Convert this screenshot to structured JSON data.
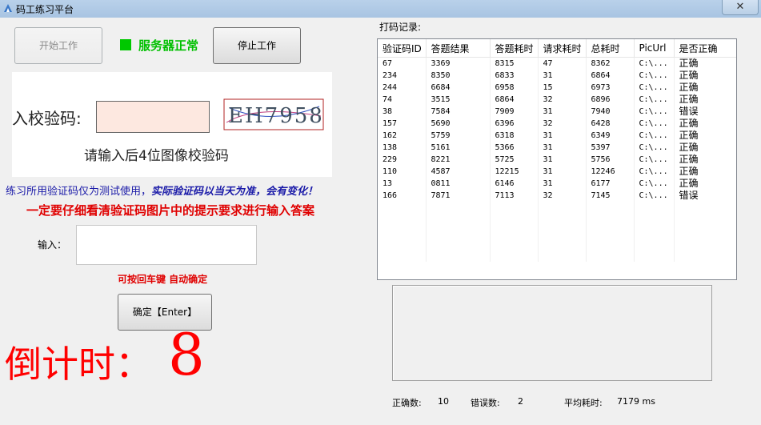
{
  "window": {
    "title": "码工练习平台",
    "close_symbol": "✕"
  },
  "toolbar": {
    "start_label": "开始工作",
    "server_status": "服务器正常",
    "stop_label": "停止工作"
  },
  "captcha": {
    "prompt_label": "入校验码:",
    "image_text": "EH7958",
    "hint": "请输入后4位图像校验码"
  },
  "notes": {
    "line1_plain": "练习所用验证码仅为测试使用，",
    "line1_emph": "实际验证码以当天为准，会有变化！",
    "line2": "一定要仔细看清验证码图片中的提示要求进行输入答案"
  },
  "answer": {
    "label": "输入：",
    "value": "",
    "enter_hint": "可按回车键 自动确定",
    "confirm_label": "确定【Enter】"
  },
  "countdown": {
    "label": "倒计时：",
    "value": "8"
  },
  "records": {
    "title": "打码记录:",
    "columns": [
      "验证码ID",
      "答题结果",
      "答题耗时",
      "请求耗时",
      "总耗时",
      "PicUrl",
      "是否正确"
    ],
    "rows": [
      [
        "67",
        "3369",
        "8315",
        "47",
        "8362",
        "C:\\...",
        "正确"
      ],
      [
        "234",
        "8350",
        "6833",
        "31",
        "6864",
        "C:\\...",
        "正确"
      ],
      [
        "244",
        "6684",
        "6958",
        "15",
        "6973",
        "C:\\...",
        "正确"
      ],
      [
        "74",
        "3515",
        "6864",
        "32",
        "6896",
        "C:\\...",
        "正确"
      ],
      [
        "38",
        "7584",
        "7909",
        "31",
        "7940",
        "C:\\...",
        "错误"
      ],
      [
        "157",
        "5690",
        "6396",
        "32",
        "6428",
        "C:\\...",
        "正确"
      ],
      [
        "162",
        "5759",
        "6318",
        "31",
        "6349",
        "C:\\...",
        "正确"
      ],
      [
        "138",
        "5161",
        "5366",
        "31",
        "5397",
        "C:\\...",
        "正确"
      ],
      [
        "229",
        "8221",
        "5725",
        "31",
        "5756",
        "C:\\...",
        "正确"
      ],
      [
        "110",
        "4587",
        "12215",
        "31",
        "12246",
        "C:\\...",
        "正确"
      ],
      [
        "13",
        "0811",
        "6146",
        "31",
        "6177",
        "C:\\...",
        "正确"
      ],
      [
        "166",
        "7871",
        "7113",
        "32",
        "7145",
        "C:\\...",
        "错误"
      ]
    ]
  },
  "stats": {
    "correct_label": "正确数:",
    "correct_value": "10",
    "error_label": "错误数:",
    "error_value": "2",
    "avg_label": "平均耗时:",
    "avg_value": "7179 ms"
  },
  "colors": {
    "status_green": "#00c000",
    "warning_red": "#e00000",
    "note_blue": "#1a1aa8"
  }
}
